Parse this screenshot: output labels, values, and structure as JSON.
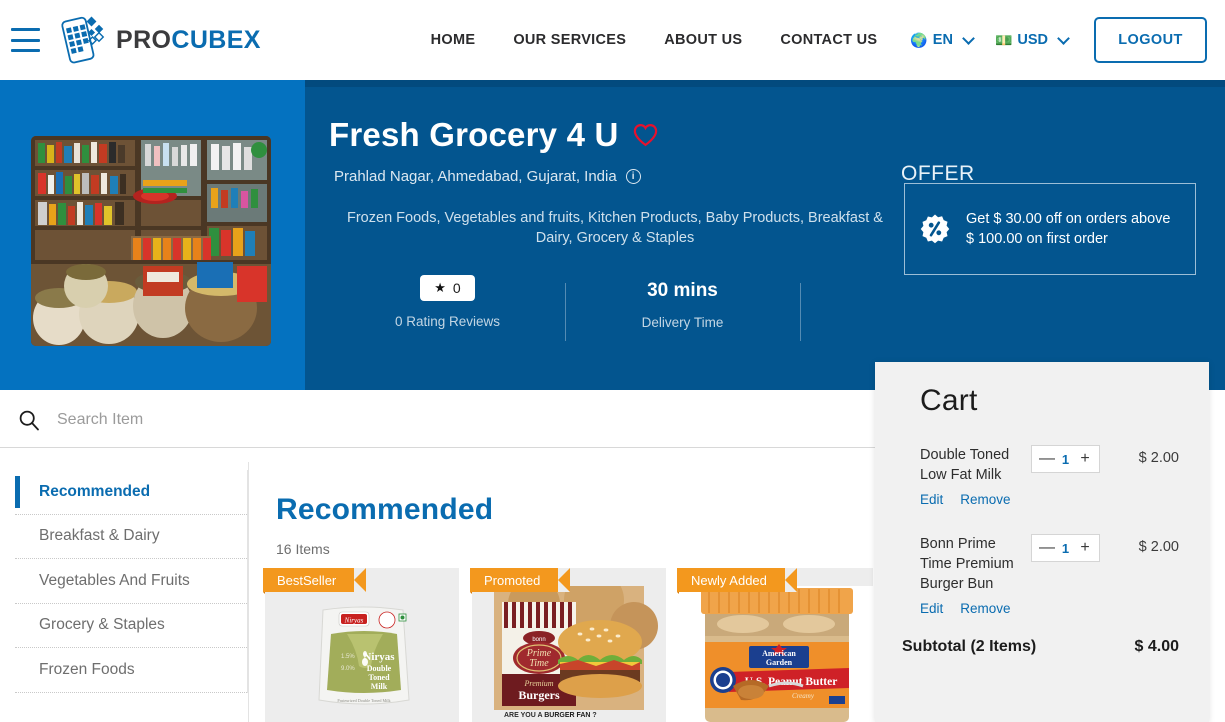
{
  "header": {
    "logo": {
      "part1": "PRO",
      "part2": "CUBEX"
    },
    "menu_icon": "hamburger-icon",
    "nav": [
      {
        "label": "HOME"
      },
      {
        "label": "OUR SERVICES"
      },
      {
        "label": "ABOUT US"
      },
      {
        "label": "CONTACT US"
      }
    ],
    "language": {
      "icon": "🌍",
      "label": "EN"
    },
    "currency": {
      "icon": "💵",
      "label": "USD"
    },
    "logout_label": "LOGOUT"
  },
  "hero": {
    "store_name": "Fresh Grocery 4 U",
    "favorite_icon": "heart-icon",
    "address": "Prahlad Nagar, Ahmedabad, Gujarat, India",
    "info_icon": "i",
    "categories": "Frozen Foods, Vegetables and fruits, Kitchen Products, Baby Products, Breakfast & Dairy, Grocery & Staples",
    "rating_value": "0",
    "rating_label": "0 Rating Reviews",
    "delivery_value": "30 mins",
    "delivery_label": "Delivery Time",
    "offer": {
      "legend": "OFFER",
      "text": "Get $ 30.00 off on orders above $ 100.00 on first order",
      "icon": "discount-badge-icon"
    }
  },
  "search": {
    "placeholder": "Search Item",
    "value": "",
    "icon": "search-icon"
  },
  "categories": [
    {
      "label": "Recommended",
      "active": true
    },
    {
      "label": "Breakfast & Dairy",
      "active": false
    },
    {
      "label": "Vegetables And Fruits",
      "active": false
    },
    {
      "label": "Grocery & Staples",
      "active": false
    },
    {
      "label": "Frozen Foods",
      "active": false
    }
  ],
  "main": {
    "title": "Recommended",
    "item_count": "16 Items",
    "products": [
      {
        "badge": "BestSeller",
        "name": "Niryas Double Toned Milk"
      },
      {
        "badge": "Promoted",
        "name": "Bonn Prime Time Premium Burgers"
      },
      {
        "badge": "Newly Added",
        "name": "American Garden U.S. Peanut Butter Creamy"
      }
    ]
  },
  "cart": {
    "title": "Cart",
    "items": [
      {
        "name": "Double Toned Low Fat Milk",
        "qty": "1",
        "price": "$ 2.00",
        "edit_label": "Edit",
        "remove_label": "Remove",
        "minus": "—",
        "plus": "+"
      },
      {
        "name": "Bonn Prime Time Premium Burger Bun",
        "qty": "1",
        "price": "$ 2.00",
        "edit_label": "Edit",
        "remove_label": "Remove",
        "minus": "—",
        "plus": "+"
      }
    ],
    "subtotal_label": "Subtotal (2 Items)",
    "subtotal_amount": "$ 4.00"
  },
  "colors": {
    "brand_blue": "#0a6cb0",
    "hero_left_blue": "#0472c0",
    "hero_right_blue": "#03558f",
    "ribbon_orange": "#f3981e",
    "heart_red": "#e8112d",
    "cart_bg": "#f1f1f1"
  }
}
